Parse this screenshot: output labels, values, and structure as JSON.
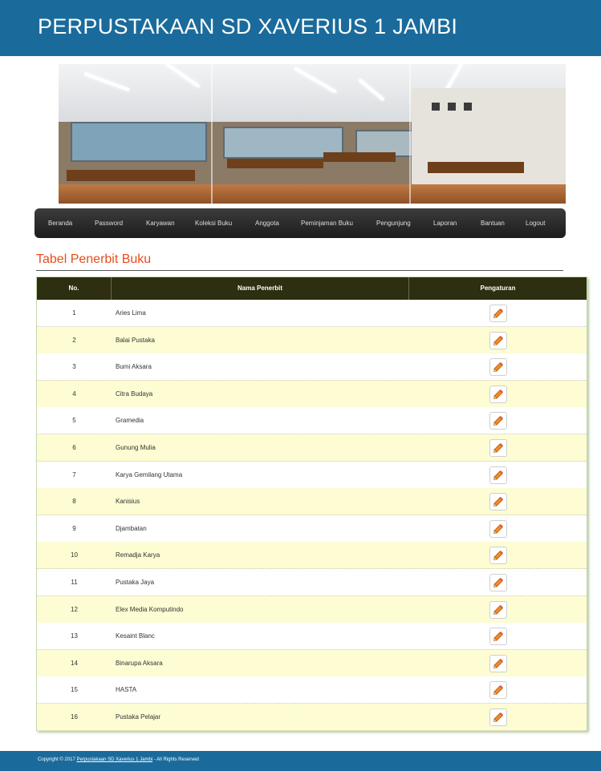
{
  "site": {
    "title": "PERPUSTAKAAN SD XAVERIUS 1 JAMBI"
  },
  "nav": {
    "items": [
      "Beranda",
      "Password",
      "Karyawan",
      "Koleksi Buku",
      "Anggota",
      "Peminjaman Buku",
      "Pengunjung",
      "Laporan",
      "Bantuan",
      "Logout"
    ]
  },
  "page": {
    "title": "Tabel Penerbit Buku"
  },
  "table": {
    "columns": [
      "No.",
      "Nama Penerbit",
      "Pengaturan"
    ],
    "rows": [
      {
        "no": "1",
        "name": "Aries Lima"
      },
      {
        "no": "2",
        "name": "Balai Pustaka"
      },
      {
        "no": "3",
        "name": "Bumi Aksara"
      },
      {
        "no": "4",
        "name": "Citra Budaya"
      },
      {
        "no": "5",
        "name": "Gramedia"
      },
      {
        "no": "6",
        "name": "Gunung Mulia"
      },
      {
        "no": "7",
        "name": "Karya Gemilang Utama"
      },
      {
        "no": "8",
        "name": "Kanisius"
      },
      {
        "no": "9",
        "name": "Djambatan"
      },
      {
        "no": "10",
        "name": "Remadja Karya"
      },
      {
        "no": "11",
        "name": "Pustaka Jaya"
      },
      {
        "no": "12",
        "name": "Elex Media Komputindo"
      },
      {
        "no": "13",
        "name": "Kesaint Blanc"
      },
      {
        "no": "14",
        "name": "Binarupa Aksara"
      },
      {
        "no": "15",
        "name": "HASTA"
      },
      {
        "no": "16",
        "name": "Pustaka Pelajar"
      }
    ],
    "action_icon": "edit-icon"
  },
  "footer": {
    "prefix": "Copyright © 2017",
    "link": "Perpustakaan SD Xaverius 1 Jambi",
    "suffix": "- All Rights Reserved"
  },
  "colors": {
    "header_bg": "#1a6b9b",
    "nav_bg": "#2a2a2a",
    "page_title": "#e84c1d",
    "table_header_bg": "#2e2e10",
    "row_alt_bg": "#fdfcd3"
  }
}
